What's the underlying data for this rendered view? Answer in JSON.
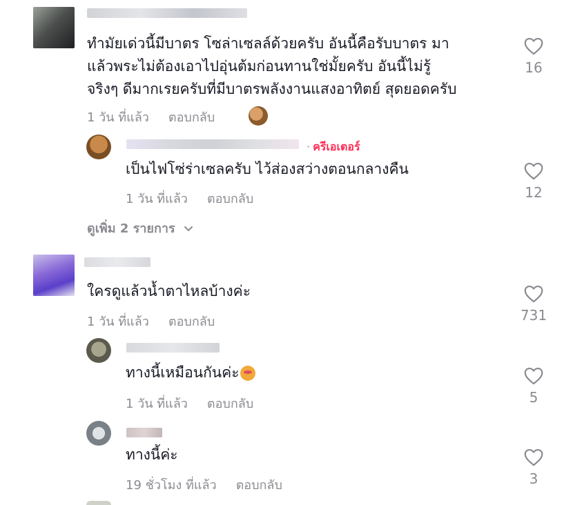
{
  "accent_color": "#fe2c55",
  "muted_color": "#8a8b91",
  "comments": [
    {
      "lines": [
        "ทำมัยเด่วนี้มีบาตร โซล่าเซลล์ด้วยครับ อันนี้คือรับบาตร มา",
        "แล้วพระไม่ต้องเอาไปอุ่นต้มก่อนทานใช่มั้ยครับ อันนี้ไม่รู้",
        "จริงๆ ดีมากเรยครับที่มีบาตรพลังงานแสงอาทิตย์ สุดยอดครับ"
      ],
      "time": "1 วัน ที่แล้ว",
      "reply_label": "ตอบกลับ",
      "likes": "16",
      "replies": [
        {
          "creator_badge": "ครีเอเตอร์",
          "text": "เป็นไฟโซ่ร่าเซลครับ ไว้ส่องสว่างตอนกลางคืน",
          "time": "1 วัน ที่แล้ว",
          "reply_label": "ตอบกลับ",
          "likes": "12"
        }
      ],
      "more_label": "ดูเพิ่ม 2 รายการ"
    },
    {
      "text": "ใครดูแล้วน้ำตาไหลบ้างค่ะ",
      "time": "1 วัน ที่แล้ว",
      "reply_label": "ตอบกลับ",
      "likes": "731",
      "replies": [
        {
          "text": "ทางนี้เหมือนกันค่ะ",
          "emoji": "crying-face-icon",
          "time": "1 วัน ที่แล้ว",
          "reply_label": "ตอบกลับ",
          "likes": "5"
        },
        {
          "text": "ทางนี้ค่ะ",
          "time": "19 ชั่วโมง ที่แล้ว",
          "reply_label": "ตอบกลับ",
          "likes": "3"
        }
      ]
    }
  ]
}
